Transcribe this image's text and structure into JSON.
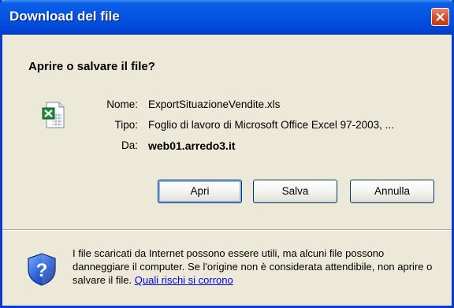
{
  "dialog": {
    "title": "Download del file",
    "heading": "Aprire o salvare il file?"
  },
  "file": {
    "icon": "excel-file-icon",
    "name_label": "Nome:",
    "name": "ExportSituazioneVendite.xls",
    "type_label": "Tipo:",
    "type": "Foglio di lavoro di Microsoft Office Excel 97-2003, ...",
    "from_label": "Da:",
    "from": "web01.arredo3.it"
  },
  "buttons": {
    "open": "Apri",
    "save": "Salva",
    "cancel": "Annulla"
  },
  "warning": {
    "icon": "security-shield-question-icon",
    "text": "I file scaricati da Internet possono essere utili, ma alcuni file possono danneggiare il computer. Se l'origine non è considerata attendibile, non aprire o salvare il file.",
    "link": "Quali rischi si corrono"
  },
  "colors": {
    "titlebar": "#0554e3",
    "dialog_bg": "#ece9d8",
    "close_button": "#d9532c",
    "link": "#0000ee"
  }
}
